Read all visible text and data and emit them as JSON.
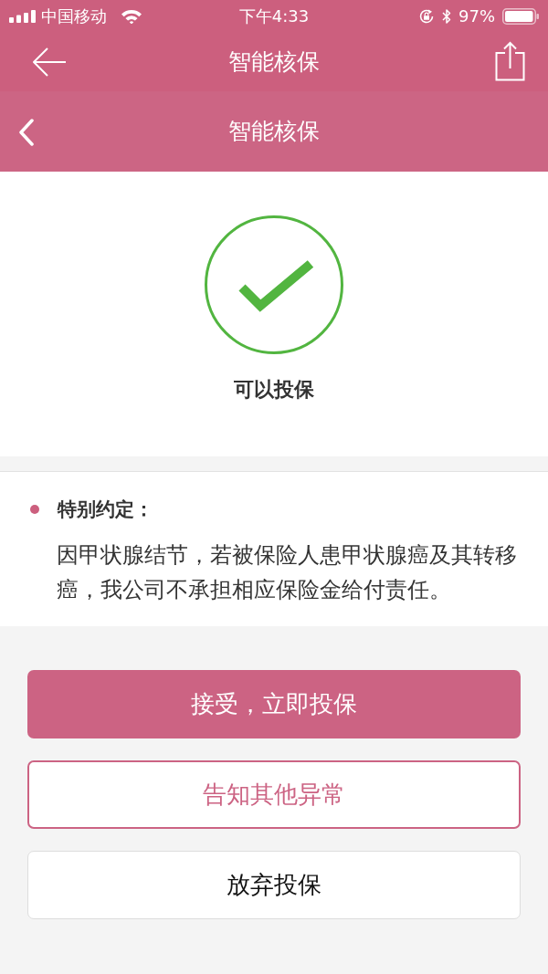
{
  "status_bar": {
    "carrier": "中国移动",
    "time": "下午4:33",
    "battery": "97%"
  },
  "app_bar": {
    "title": "智能核保"
  },
  "page_header": {
    "title": "智能核保"
  },
  "result": {
    "status": "可以投保"
  },
  "notice": {
    "heading": "特别约定：",
    "body": "因甲状腺结节，若被保险人患甲状腺癌及其转移癌，我公司不承担相应保险金给付责任。"
  },
  "buttons": [
    {
      "label": "接受，立即投保",
      "kind": "primary"
    },
    {
      "label": "告知其他异常",
      "kind": "outline"
    },
    {
      "label": "放弃投保",
      "kind": "plain"
    }
  ]
}
